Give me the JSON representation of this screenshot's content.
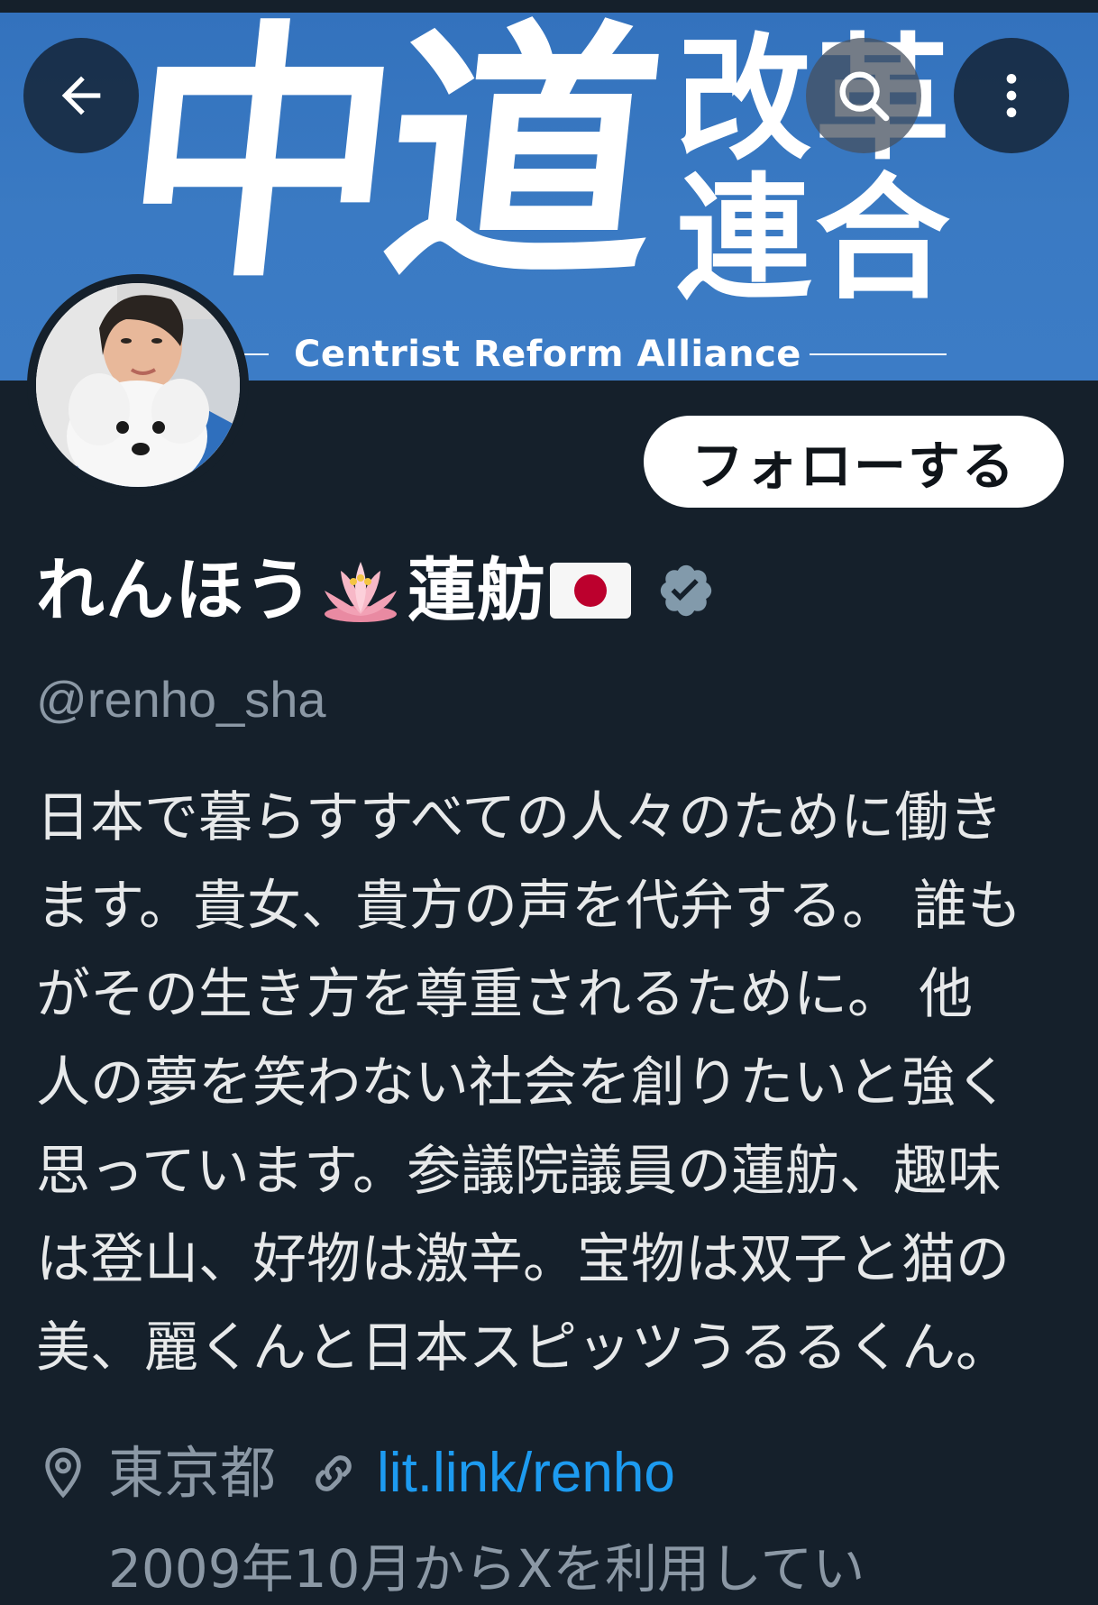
{
  "banner": {
    "big_text": "中道",
    "stack_line1": "改革",
    "stack_line2": "連合",
    "caption": "Centrist Reform Alliance"
  },
  "nav": {
    "back_icon": "arrow-left-icon",
    "search_icon": "search-icon",
    "more_icon": "more-vertical-icon"
  },
  "profile": {
    "name_part1": "れんほう",
    "name_part2": "蓮舫",
    "handle": "@renho_sha",
    "verified_color": "#829aab",
    "bio": "日本で暮らすすべての人々のために働き\nます。貴女、貴方の声を代弁する。 誰も\nがその生き方を尊重されるために。 他\n人の夢を笑わない社会を創りたいと強く\n思っています。参議院議員の蓮舫、趣味\nは登山、好物は激辛。宝物は双子と猫の\n美、麗くんと日本スピッツうるるくん。",
    "location": "東京都",
    "link": "lit.link/renho",
    "joined": "2009年10月からXを利用してい"
  },
  "actions": {
    "follow_label": "フォローする"
  },
  "colors": {
    "background": "#15202b",
    "banner": "#3a7ac3",
    "link": "#1d9bf0",
    "muted": "#8b98a5"
  }
}
